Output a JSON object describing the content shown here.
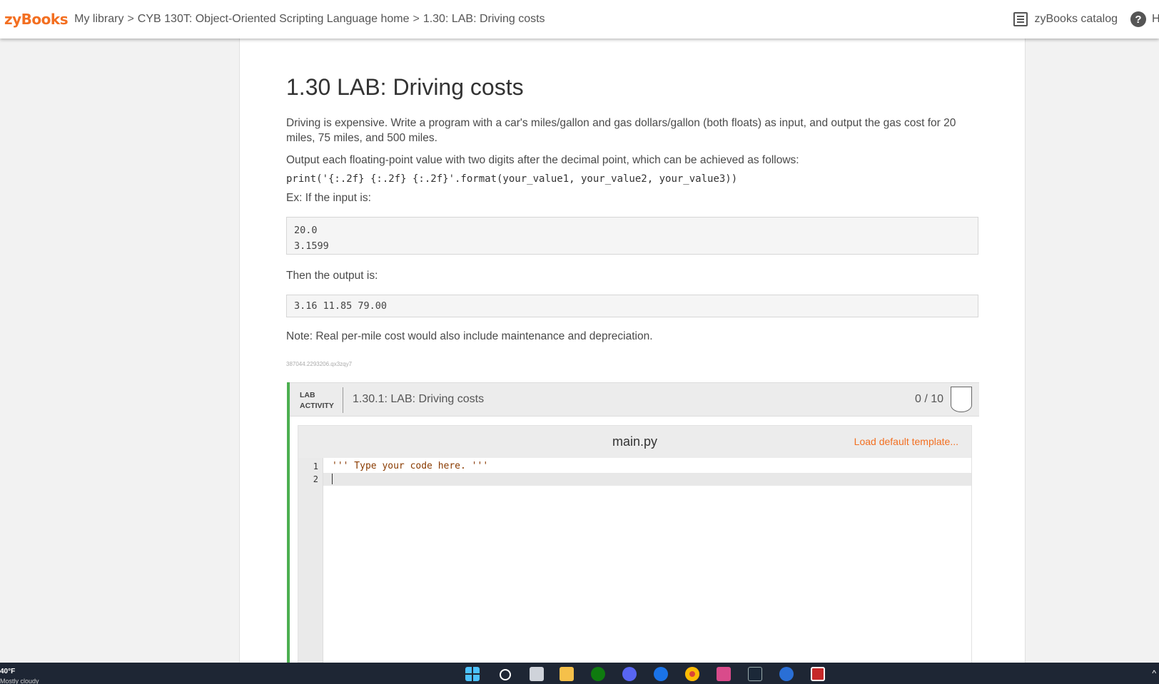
{
  "topbar": {
    "logo": "zyBooks",
    "breadcrumb": [
      "My library",
      "CYB 130T: Object-Oriented Scripting Language home",
      "1.30: LAB: Driving costs"
    ],
    "separator": ">",
    "catalog_label": "zyBooks catalog",
    "help_symbol": "?",
    "cut_text": "H"
  },
  "section": {
    "title": "1.30 LAB: Driving costs",
    "intro": "Driving is expensive. Write a program with a car's miles/gallon and gas dollars/gallon (both floats) as input, and output the gas cost for 20 miles, 75 miles, and 500 miles.",
    "format_instruction": "Output each floating-point value with two digits after the decimal point, which can be achieved as follows:",
    "format_code": "print('{:.2f} {:.2f} {:.2f}'.format(your_value1, your_value2, your_value3))",
    "example_input_label": "Ex: If the input is:",
    "example_input_lines": [
      "20.0",
      "3.1599"
    ],
    "example_output_label": "Then the output is:",
    "example_output": "3.16 11.85 79.00",
    "note": "Note: Real per-mile cost would also include maintenance and depreciation.",
    "content_id": "387044.2293206.qx3zqy7"
  },
  "lab_activity": {
    "kind_line1": "LAB",
    "kind_line2": "ACTIVITY",
    "title": "1.30.1: LAB: Driving costs",
    "score": "0 / 10",
    "accent_color": "#4caf50"
  },
  "editor": {
    "filename": "main.py",
    "load_template_label": "Load default template...",
    "line_numbers": [
      "1",
      "2"
    ],
    "code_line1": "''' Type your code here. '''",
    "code_line2": ""
  },
  "taskbar": {
    "weather_temp": "40°F",
    "weather_desc": "Mostly cloudy",
    "chevron": "^"
  },
  "colors": {
    "brand": "#f36f21",
    "taskbar": "#1e2634"
  }
}
